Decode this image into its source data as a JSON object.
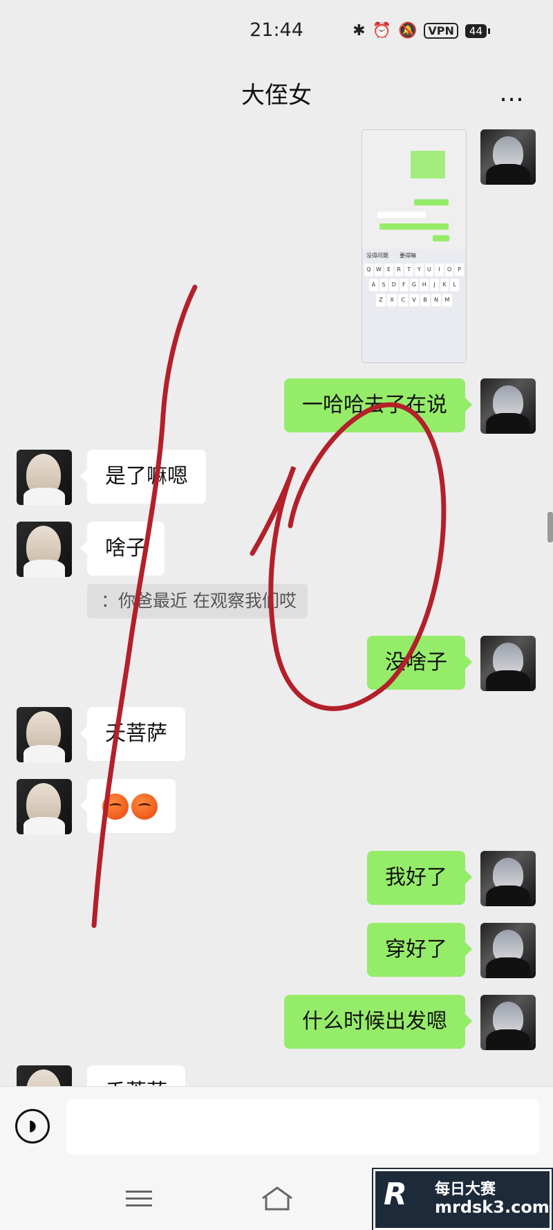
{
  "status_bar": {
    "time": "21:44",
    "vpn": "VPN",
    "battery": "44",
    "icons": [
      "bluetooth-icon",
      "alarm-icon",
      "mute-bell-icon"
    ]
  },
  "header": {
    "title": "大侄女",
    "more_icon": "…"
  },
  "messages": [
    {
      "side": "right",
      "type": "image",
      "desc": "screenshot"
    },
    {
      "side": "right",
      "text": "一哈哈去了在说"
    },
    {
      "side": "left",
      "text": "是了嘛嗯"
    },
    {
      "side": "left",
      "text": "啥子"
    },
    {
      "side": "left",
      "type": "quote",
      "text": "：你爸最近 在观察我们哎"
    },
    {
      "side": "right",
      "text": "没啥子"
    },
    {
      "side": "left",
      "text": "夭菩萨"
    },
    {
      "side": "left",
      "type": "emoji",
      "emoji": [
        "hot-face-icon",
        "hot-face-icon"
      ]
    },
    {
      "side": "right",
      "text": "我好了"
    },
    {
      "side": "right",
      "text": "穿好了"
    },
    {
      "side": "right",
      "text": "什么时候出发嗯"
    },
    {
      "side": "left",
      "text": "夭菩萨"
    }
  ],
  "embedded_screenshot": {
    "keyboard_row1": [
      "Q",
      "W",
      "E",
      "R",
      "T",
      "Y",
      "U",
      "I",
      "O",
      "P"
    ],
    "keyboard_row2": [
      "A",
      "S",
      "D",
      "F",
      "G",
      "H",
      "J",
      "K",
      "L"
    ],
    "keyboard_row3": [
      "Z",
      "X",
      "C",
      "V",
      "B",
      "N",
      "M"
    ],
    "suggestion1": "没得问题",
    "suggestion2": "要得嘛"
  },
  "input": {
    "voice_icon": "voice-icon",
    "placeholder": ""
  },
  "nav": {
    "menu_icon": "menu-icon",
    "home_icon": "home-icon"
  },
  "watermark": {
    "logo": "R",
    "title": "每日大赛",
    "url": "mrdsk3.com"
  },
  "colors": {
    "sent_bubble": "#95ec69",
    "received_bubble": "#ffffff",
    "background": "#ededed",
    "annotation": "#b3202a"
  }
}
